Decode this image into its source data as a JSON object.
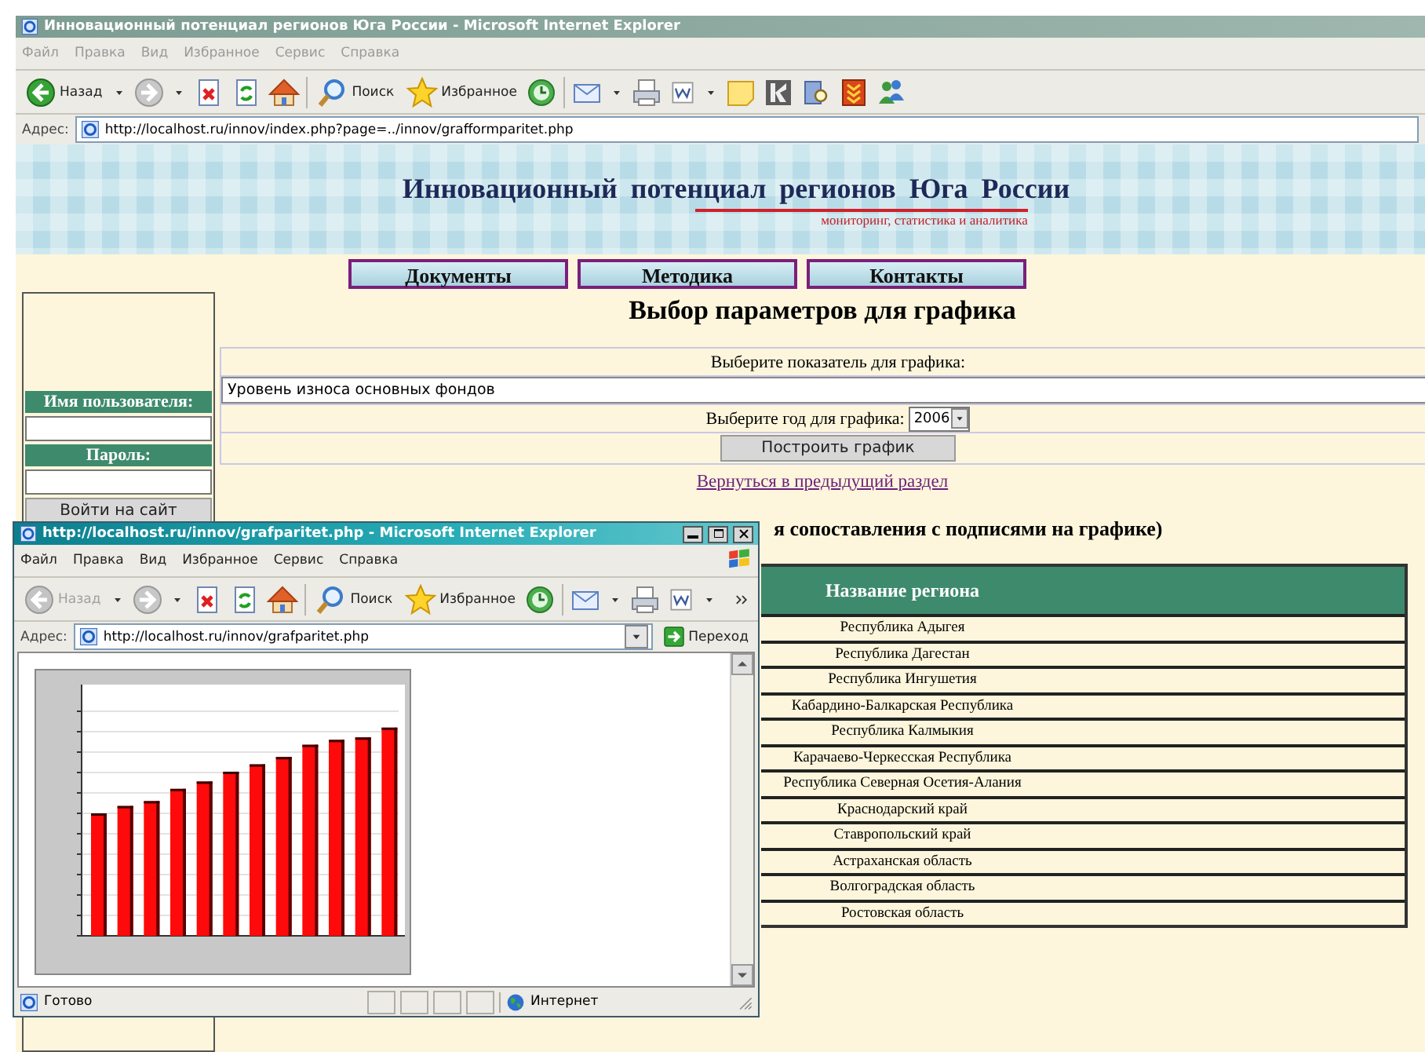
{
  "main_window": {
    "title": "Инновационный потенциал регионов Юга России - Microsoft Internet Explorer",
    "active": false,
    "menu": [
      "Файл",
      "Правка",
      "Вид",
      "Избранное",
      "Сервис",
      "Справка"
    ],
    "toolbar": {
      "back": {
        "label": "Назад",
        "disabled": false
      },
      "search": "Поиск",
      "favorites": "Избранное"
    },
    "address_label": "Адрес:",
    "address": "http://localhost.ru/innov/index.php?page=../innov/grafformparitet.php"
  },
  "site": {
    "title": "Инновационный потенциал регионов Юга России",
    "subtitle": "мониторинг, статистика и аналитика",
    "nav": [
      "Документы",
      "Методика",
      "Контакты"
    ]
  },
  "login": {
    "username_label": "Имя пользователя:",
    "password_label": "Пароль:",
    "login_button": "Войти на сайт"
  },
  "form": {
    "heading": "Выбор параметров для графика",
    "indicator_label": "Выберите показатель для графика:",
    "indicator_value": "Уровень износа основных фондов",
    "year_label": "Выберите год для графика:",
    "year_value": "2006",
    "build_button": "Построить график",
    "back_link": "Вернуться в предыдущий раздел"
  },
  "comparison": {
    "heading": "я сопоставления с подписями на графике)",
    "column": "Название региона",
    "regions": [
      "Республика Адыгея",
      "Республика Дагестан",
      "Республика Ингушетия",
      "Кабардино-Балкарская Республика",
      "Республика Калмыкия",
      "Карачаево-Черкесская Республика",
      "Республика Северная Осетия-Алания",
      "Краснодарский край",
      "Ставропольский край",
      "Астраханская область",
      "Волгоградская область",
      "Ростовская область"
    ]
  },
  "popup": {
    "title": "http://localhost.ru/innov/grafparitet.php - Microsoft Internet Explorer",
    "active": true,
    "menu": [
      "Файл",
      "Правка",
      "Вид",
      "Избранное",
      "Сервис",
      "Справка"
    ],
    "toolbar": {
      "back": {
        "label": "Назад",
        "disabled": true
      },
      "search": "Поиск",
      "favorites": "Избранное"
    },
    "address_label": "Адрес:",
    "address": "http://localhost.ru/innov/grafparitet.php",
    "go_button": "Переход",
    "status": "Готово",
    "zone": "Интернет"
  }
}
